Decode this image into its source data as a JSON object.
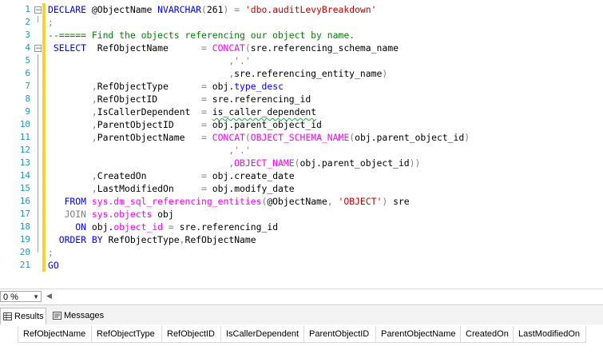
{
  "editor": {
    "lines": [
      {
        "num": "1",
        "segs": [
          [
            "kw",
            "DECLARE "
          ],
          [
            "tx",
            "@ObjectName "
          ],
          [
            "kw",
            "NVARCHAR"
          ],
          [
            "gr",
            "("
          ],
          [
            "tx",
            "261"
          ],
          [
            "gr",
            ")"
          ],
          [
            "tx",
            " "
          ],
          [
            "gr",
            "="
          ],
          [
            "tx",
            " "
          ],
          [
            "str",
            "'dbo.auditLevyBreakdown'"
          ]
        ]
      },
      {
        "num": "2",
        "segs": [
          [
            "gr",
            ";"
          ]
        ]
      },
      {
        "num": "3",
        "segs": [
          [
            "cm",
            "--===== Find the objects referencing our object by name."
          ]
        ]
      },
      {
        "num": "4",
        "segs": [
          [
            "tx",
            " "
          ],
          [
            "kw",
            "SELECT"
          ],
          [
            "tx",
            "  RefObjectName      "
          ],
          [
            "gr",
            "="
          ],
          [
            "tx",
            " "
          ],
          [
            "fn",
            "CONCAT"
          ],
          [
            "gr",
            "("
          ],
          [
            "tx",
            "sre.referencing_schema_name"
          ]
        ]
      },
      {
        "num": "5",
        "segs": [
          [
            "tx",
            "                                 "
          ],
          [
            "gr",
            ",'.'"
          ]
        ]
      },
      {
        "num": "6",
        "segs": [
          [
            "tx",
            "                                 "
          ],
          [
            "gr",
            ","
          ],
          [
            "tx",
            "sre.referencing_entity_name"
          ],
          [
            "gr",
            ")"
          ]
        ]
      },
      {
        "num": "7",
        "segs": [
          [
            "tx",
            "        "
          ],
          [
            "gr",
            ","
          ],
          [
            "tx",
            "RefObjectType      "
          ],
          [
            "gr",
            "="
          ],
          [
            "tx",
            " obj."
          ],
          [
            "kw",
            "type_desc"
          ]
        ]
      },
      {
        "num": "8",
        "segs": [
          [
            "tx",
            "        "
          ],
          [
            "gr",
            ","
          ],
          [
            "tx",
            "RefObjectID        "
          ],
          [
            "gr",
            "="
          ],
          [
            "tx",
            " sre.referencing_id"
          ]
        ]
      },
      {
        "num": "9",
        "segs": [
          [
            "tx",
            "        "
          ],
          [
            "gr",
            ","
          ],
          [
            "tx",
            "IsCallerDependent  "
          ],
          [
            "gr",
            "="
          ],
          [
            "tx",
            " "
          ],
          [
            "sq",
            "is_caller_dependent"
          ]
        ]
      },
      {
        "num": "10",
        "segs": [
          [
            "tx",
            "        "
          ],
          [
            "gr",
            ","
          ],
          [
            "tx",
            "ParentObjectID     "
          ],
          [
            "gr",
            "="
          ],
          [
            "tx",
            " obj.parent_object_id"
          ]
        ]
      },
      {
        "num": "11",
        "segs": [
          [
            "tx",
            "        "
          ],
          [
            "gr",
            ","
          ],
          [
            "tx",
            "ParentObjectName   "
          ],
          [
            "gr",
            "="
          ],
          [
            "tx",
            " "
          ],
          [
            "fn",
            "CONCAT"
          ],
          [
            "gr",
            "("
          ],
          [
            "fn",
            "OBJECT_SCHEMA_NAME"
          ],
          [
            "gr",
            "("
          ],
          [
            "tx",
            "obj.parent_object_id"
          ],
          [
            "gr",
            ")"
          ]
        ]
      },
      {
        "num": "12",
        "segs": [
          [
            "tx",
            "                                 "
          ],
          [
            "gr",
            ",'.'"
          ]
        ]
      },
      {
        "num": "13",
        "segs": [
          [
            "tx",
            "                                 "
          ],
          [
            "gr",
            ","
          ],
          [
            "fn",
            "OBJECT_NAME"
          ],
          [
            "gr",
            "("
          ],
          [
            "tx",
            "obj.parent_object_id"
          ],
          [
            "gr",
            "))"
          ]
        ]
      },
      {
        "num": "14",
        "segs": [
          [
            "tx",
            "        "
          ],
          [
            "gr",
            ","
          ],
          [
            "tx",
            "CreatedOn          "
          ],
          [
            "gr",
            "="
          ],
          [
            "tx",
            " obj.create_date"
          ]
        ]
      },
      {
        "num": "15",
        "segs": [
          [
            "tx",
            "        "
          ],
          [
            "gr",
            ","
          ],
          [
            "tx",
            "LastModifiedOn     "
          ],
          [
            "gr",
            "="
          ],
          [
            "tx",
            " obj.modify_date"
          ]
        ]
      },
      {
        "num": "16",
        "segs": [
          [
            "tx",
            "   "
          ],
          [
            "kw",
            "FROM"
          ],
          [
            "tx",
            " "
          ],
          [
            "fn",
            "sys.dm_sql_referencing_entities"
          ],
          [
            "gr",
            "("
          ],
          [
            "tx",
            "@ObjectName"
          ],
          [
            "gr",
            ","
          ],
          [
            "tx",
            " "
          ],
          [
            "str",
            "'OBJECT'"
          ],
          [
            "gr",
            ")"
          ],
          [
            "tx",
            " sre"
          ]
        ]
      },
      {
        "num": "17",
        "segs": [
          [
            "tx",
            "   "
          ],
          [
            "gr",
            "JOIN"
          ],
          [
            "tx",
            " "
          ],
          [
            "fn",
            "sys.objects"
          ],
          [
            "tx",
            " obj"
          ]
        ]
      },
      {
        "num": "18",
        "segs": [
          [
            "tx",
            "     "
          ],
          [
            "kw",
            "ON"
          ],
          [
            "tx",
            " obj."
          ],
          [
            "fn",
            "object_id"
          ],
          [
            "tx",
            " "
          ],
          [
            "gr",
            "="
          ],
          [
            "tx",
            " sre.referencing_id"
          ]
        ]
      },
      {
        "num": "19",
        "segs": [
          [
            "tx",
            "  "
          ],
          [
            "kw",
            "ORDER BY"
          ],
          [
            "tx",
            " RefObjectType"
          ],
          [
            "gr",
            ","
          ],
          [
            "tx",
            "RefObjectName"
          ]
        ]
      },
      {
        "num": "20",
        "segs": [
          [
            "gr",
            ";"
          ]
        ]
      },
      {
        "num": "21",
        "segs": [
          [
            "kw",
            "GO"
          ]
        ]
      }
    ]
  },
  "zoom": {
    "value": "0 %"
  },
  "tabs": [
    {
      "label": "Results",
      "active": true,
      "icon": "grid-icon"
    },
    {
      "label": "Messages",
      "active": false,
      "icon": "messages-icon"
    }
  ],
  "results": {
    "columns": [
      "RefObjectName",
      "RefObjectType",
      "RefObjectID",
      "IsCallerDependent",
      "ParentObjectID",
      "ParentObjectName",
      "CreatedOn",
      "LastModifiedOn"
    ]
  },
  "colors": {
    "keyword": "#0000ff",
    "function": "#ff00ff",
    "string": "#c00000",
    "comment": "#008000",
    "operator": "#808080",
    "line_number": "#2b91af"
  }
}
